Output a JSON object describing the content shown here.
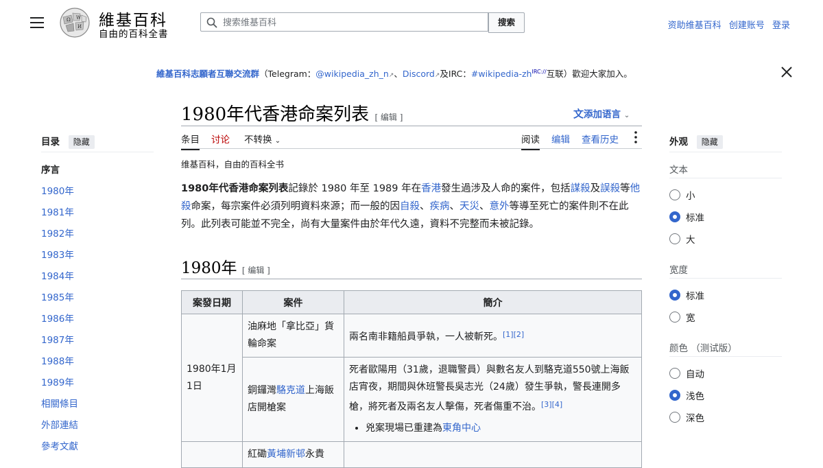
{
  "header": {
    "wordmark": "維基百科",
    "tagline": "自由的百科全書",
    "search_placeholder": "搜索维基百科",
    "search_button": "搜索",
    "links": [
      "资助维基百科",
      "创建账号",
      "登录"
    ]
  },
  "banner": {
    "group": "維基百科志願者互聯交流群",
    "p1": "（Telegram：",
    "telegram": "@wikipedia_zh_n",
    "sep": "、",
    "discord": "Discord",
    "p2": "及IRC：",
    "irc": "#wikipedia-zh",
    "irc_sup": "IRC://",
    "p3": "互联）歡迎大家加入。"
  },
  "article": {
    "title": "1980年代香港命案列表",
    "edit": "[ 编辑 ]",
    "add_languages": "添加语言",
    "tabs_left": [
      "条目",
      "讨论",
      "不转换"
    ],
    "tabs_right": [
      "阅读",
      "编辑",
      "查看历史"
    ],
    "site_sub": "维基百科，自由的百科全书",
    "intro": {
      "b": "1980年代香港命案列表",
      "t1": "記錄於 1980 年至 1989 年在",
      "l1": "香港",
      "t2": "發生過涉及人命的案件，包括",
      "l2": "謀殺",
      "t3": "及",
      "l3": "誤殺",
      "t4": "等",
      "l4": "他殺",
      "t5": "命案，每宗案件必須列明資料來源；而一般的因",
      "l5": "自殺",
      "t6": "、",
      "l6": "疾病",
      "t7": "、",
      "l7": "天災",
      "t8": "、",
      "l8": "意外",
      "t9": "等導至死亡的案件則不在此列。此列表可能並不完全，尚有大量案件由於年代久遠，資料不完整而未被記錄。"
    },
    "section": "1980年",
    "section_edit": "[ 编辑 ]",
    "table": {
      "headers": [
        "案發日期",
        "案件",
        "簡介"
      ],
      "date1": "1980年1月1日",
      "case1": "油麻地「拿比亞」貨輪命案",
      "desc1": "兩名南非籍船員爭執，一人被斬死。",
      "ref1": "[1][2]",
      "case2a": "銅鑼灣",
      "case2link": "駱克道",
      "case2b": "上海飯店開槍案",
      "desc2": "死者歐陽用（31歲，退職警員）與數名友人到駱克道550號上海飯店宵夜，期間與休班警長吳志光（24歲）發生爭執，警長連開多槍，將死者及兩名友人擊傷，死者傷重不治。",
      "ref2": "[3][4]",
      "bullet_text": "兇案現場已重建為",
      "bullet_link": "東角中心",
      "case3a": "紅磡",
      "case3link": "黃埔新邨",
      "case3b": "永貴"
    }
  },
  "toc": {
    "title": "目录",
    "hide": "隐藏",
    "items": [
      "序言",
      "1980年",
      "1981年",
      "1982年",
      "1983年",
      "1984年",
      "1985年",
      "1986年",
      "1987年",
      "1988年",
      "1989年",
      "相關條目",
      "外部連結",
      "參考文獻"
    ]
  },
  "appearance": {
    "title": "外观",
    "hide": "隐藏",
    "text_label": "文本",
    "text_options": [
      "小",
      "标准",
      "大"
    ],
    "text_selected": "标准",
    "width_label": "宽度",
    "width_options": [
      "标准",
      "宽"
    ],
    "width_selected": "标准",
    "color_label": "颜色 （测试版）",
    "color_options": [
      "自动",
      "浅色",
      "深色"
    ],
    "color_selected": "浅色"
  },
  "colors": {
    "link": "#3366cc",
    "text": "#202122",
    "radio_on": "#3366cc"
  }
}
